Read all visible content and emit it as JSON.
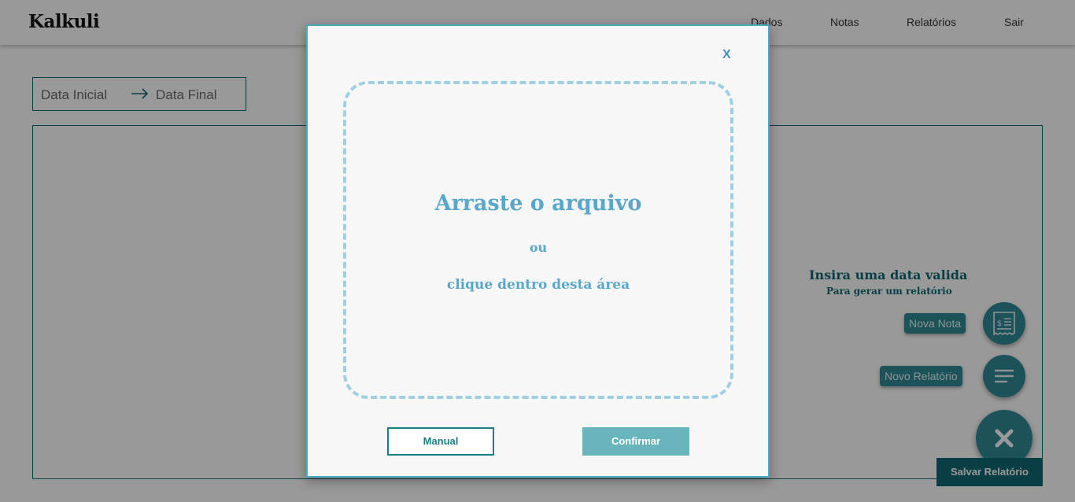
{
  "app": {
    "brand": "Kalkuli"
  },
  "nav": {
    "items": [
      {
        "label": "Dados"
      },
      {
        "label": "Notas"
      },
      {
        "label": "Relatórios"
      },
      {
        "label": "Sair"
      }
    ]
  },
  "date_range": {
    "start_placeholder": "Data Inicial",
    "end_placeholder": "Data Final"
  },
  "report": {
    "hint_title": "Insira uma data valida",
    "hint_subtitle": "Para gerar um relatório",
    "save_label": "Salvar Relatório"
  },
  "fab": {
    "new_note_label": "Nova Nota",
    "new_report_label": "Novo Relatório",
    "new_note_icon": "receipt-icon",
    "new_report_icon": "lines-icon",
    "main_icon": "close-icon"
  },
  "modal": {
    "close_label": "X",
    "dropzone_title": "Arraste o arquivo",
    "dropzone_or": "ou",
    "dropzone_click": "clique dentro desta área",
    "manual_label": "Manual",
    "confirm_label": "Confirmar"
  },
  "colors": {
    "primary": "#0e6a74",
    "fab": "#2f8a98",
    "modal_accent": "#5aa7cc",
    "confirm": "#68b5bc"
  }
}
